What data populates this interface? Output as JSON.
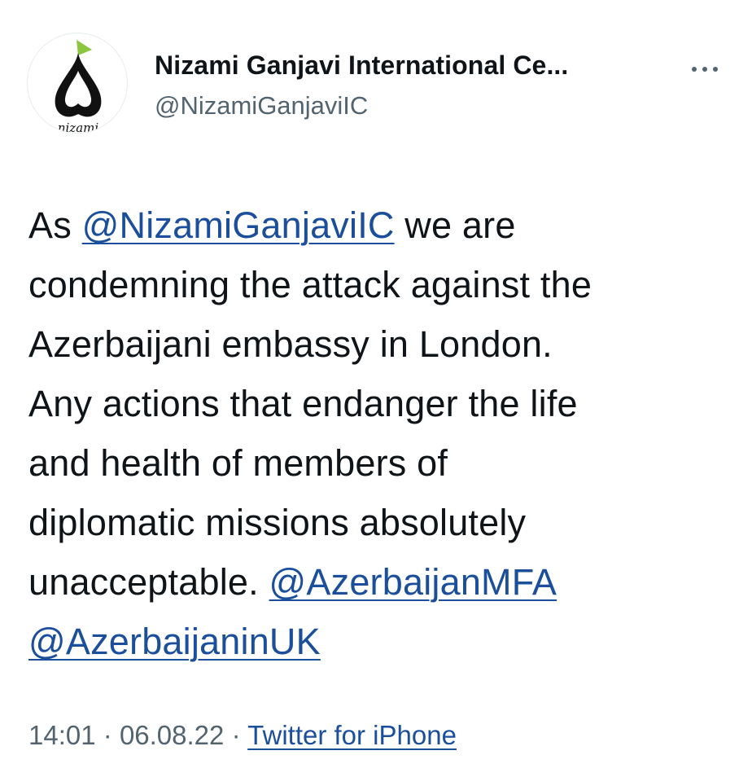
{
  "author": {
    "display_name": "Nizami Ganjavi International Ce...",
    "handle": "@NizamiGanjaviIC",
    "avatar_text": "nizami",
    "avatar_icon": "nizami-logo-icon",
    "more_icon": "more-dots-icon"
  },
  "tweet": {
    "lines": [
      {
        "before": "As ",
        "mention": "@NizamiGanjaviIC",
        "after": " we are"
      },
      {
        "text": "condemning the attack against the"
      },
      {
        "text": "Azerbaijani embassy in London."
      },
      {
        "text": "Any actions that endanger the life"
      },
      {
        "text": "and health of members of"
      },
      {
        "text": "diplomatic missions absolutely"
      },
      {
        "before": "unacceptable. ",
        "mention": "@AzerbaijanMFA"
      },
      {
        "mention": "@AzerbaijaninUK"
      }
    ]
  },
  "meta": {
    "time": "14:01",
    "separator": "·",
    "date": "06.08.22",
    "source": "Twitter for iPhone"
  },
  "colors": {
    "link": "#1b4f9c",
    "text": "#0f1419",
    "secondary": "#536471",
    "logo_green": "#8cc63f",
    "logo_black": "#111111"
  }
}
